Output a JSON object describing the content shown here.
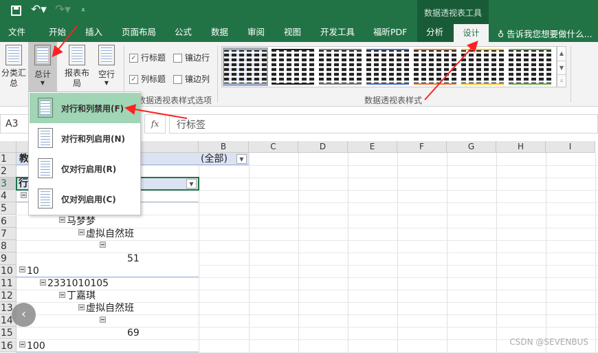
{
  "quick_access": {
    "icons": [
      "save-icon",
      "undo-icon",
      "redo-icon",
      "customize-icon"
    ]
  },
  "context_tab_group": "数据透视表工具",
  "tabs": [
    "文件",
    "开始",
    "插入",
    "页面布局",
    "公式",
    "数据",
    "审阅",
    "视图",
    "开发工具",
    "福昕PDF",
    "分析",
    "设计"
  ],
  "active_tab": "设计",
  "tell_me": "告诉我您想要做什么...",
  "ribbon": {
    "subtotals": "分类汇总",
    "grand_totals": "总计",
    "report_layout": "报表布局",
    "blank_rows": "空行",
    "options": {
      "row_headers": "行标题",
      "banded_rows": "镶边行",
      "column_headers": "列标题",
      "banded_columns": "镶边列"
    },
    "options_checked": {
      "row_headers": true,
      "banded_rows": false,
      "column_headers": true,
      "banded_columns": false
    },
    "options_group": "数据透视表样式选项",
    "styles_group": "数据透视表样式",
    "style_colors": [
      "#8eaadb",
      "#222222",
      "#7f7f7f",
      "#4472c4",
      "#ed7d31",
      "#ffc000",
      "#70ad47"
    ]
  },
  "menu": {
    "items": [
      "对行和列禁用(F)",
      "对行和列启用(N)",
      "仅对行启用(R)",
      "仅对列启用(C)"
    ],
    "selected": 0
  },
  "formula_bar": {
    "name_box": "A3",
    "fx": "fx",
    "formula": "行标签"
  },
  "columns": [
    "A",
    "B",
    "C",
    "D",
    "E",
    "F",
    "G",
    "H",
    "I"
  ],
  "rows": [
    "1",
    "2",
    "3",
    "4",
    "5",
    "6",
    "7",
    "8",
    "9",
    "10",
    "11",
    "12",
    "13",
    "14",
    "15",
    "16"
  ],
  "cells": {
    "a1": "教",
    "b1": "(全部)",
    "a3": "行",
    "a6": "马梦梦",
    "a7": "虚拟自然班",
    "a9": "51",
    "a10": "10",
    "a11": "2331010105",
    "a12": "丁嘉琪",
    "a13": "虚拟自然班",
    "a15": "69",
    "a16": "100"
  },
  "watermark": "CSDN @SEVENBUS"
}
